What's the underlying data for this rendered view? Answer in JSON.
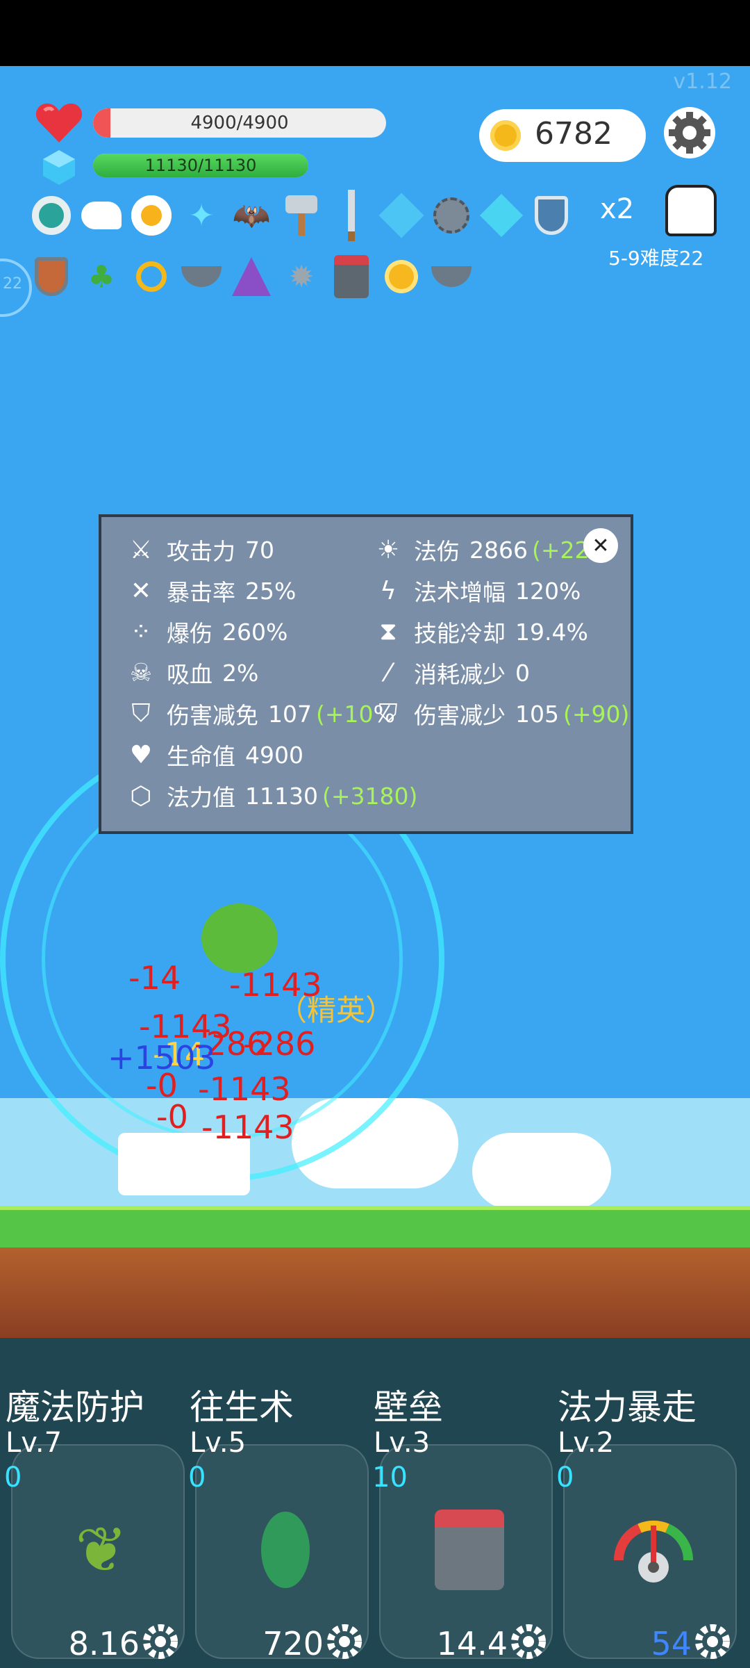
{
  "version": "v1.12",
  "hp": {
    "text": "4900/4900",
    "fill": 1.0
  },
  "mp": {
    "text": "11130/11130",
    "fill": 1.0
  },
  "coins": "6782",
  "speed": "x2",
  "stage": "5-9难度22",
  "level_badge": "22",
  "items_row1": [
    "ring-item-icon",
    "wing-item-icon",
    "egg-item-icon",
    "crystal-item-icon",
    "bat-item-icon",
    "axe-item-icon",
    "sword-item-icon",
    "ice-cube-item-icon",
    "mace-item-icon",
    "diamond-item-icon",
    "shield-item-icon"
  ],
  "items_row2": [
    "wood-shield-item-icon",
    "plant-item-icon",
    "gold-ring-item-icon",
    "mortar-item-icon",
    "wizard-hat-item-icon",
    "spike-ball-item-icon",
    "armor-item-icon",
    "sun-orb-item-icon",
    "mortar2-item-icon"
  ],
  "stats": {
    "left": [
      {
        "icon": "axe-icon",
        "label": "攻击力",
        "value": "70",
        "bonus": ""
      },
      {
        "icon": "crit-icon",
        "label": "暴击率",
        "value": "25%",
        "bonus": ""
      },
      {
        "icon": "burst-icon",
        "label": "爆伤",
        "value": "260%",
        "bonus": ""
      },
      {
        "icon": "skull-icon",
        "label": "吸血",
        "value": "2%",
        "bonus": ""
      },
      {
        "icon": "shield-icon",
        "label": "伤害减免",
        "value": "107",
        "bonus": "(+10",
        "trail": "%"
      },
      {
        "icon": "heart-icon",
        "label": "生命值",
        "value": "4900",
        "bonus": ""
      },
      {
        "icon": "hexagon-icon",
        "label": "法力值",
        "value": "11130",
        "bonus": "(+3180)"
      }
    ],
    "right": [
      {
        "icon": "sun-icon",
        "label": "法伤",
        "value": "2866",
        "bonus": "(+222"
      },
      {
        "icon": "lightning-icon",
        "label": "法术增幅",
        "value": "120%",
        "bonus": ""
      },
      {
        "icon": "hourglass-icon",
        "label": "技能冷却",
        "value": "19.4%",
        "bonus": ""
      },
      {
        "icon": "wand-icon",
        "label": "消耗减少",
        "value": "0",
        "bonus": ""
      },
      {
        "icon": "heart-shield-icon",
        "label": "伤害减少",
        "value": "105",
        "bonus": "(+90)"
      }
    ]
  },
  "battle": {
    "elite_label": "（精英）",
    "damage_numbers": [
      "-14",
      "-1143",
      "-1143",
      "-14",
      "-286",
      "-286",
      "+1503",
      "-0",
      "-0",
      "-1143",
      "-1143"
    ]
  },
  "skills": [
    {
      "name": "魔法防护",
      "level": "Lv.7",
      "count": "0",
      "value": "8.16",
      "value_color": "white",
      "icon": "leaf-sprout-icon"
    },
    {
      "name": "往生术",
      "level": "Lv.5",
      "count": "0",
      "value": "720",
      "value_color": "white",
      "icon": "leaf-icon"
    },
    {
      "name": "壁垒",
      "level": "Lv.3",
      "count": "10",
      "value": "14.4",
      "value_color": "white",
      "icon": "armor-icon"
    },
    {
      "name": "法力暴走",
      "level": "Lv.2",
      "count": "0",
      "value": "54",
      "value_color": "blue",
      "icon": "gauge-icon"
    }
  ]
}
